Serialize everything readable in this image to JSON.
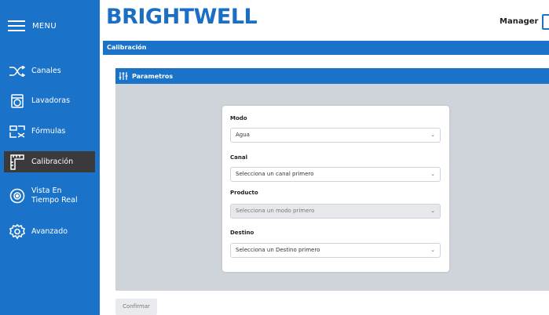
{
  "sidebar": {
    "menu_label": "MENU",
    "items": [
      {
        "label": "Canales",
        "icon": "shuffle-icon"
      },
      {
        "label": "Lavadoras",
        "icon": "washing-machine-icon"
      },
      {
        "label": "Fórmulas",
        "icon": "formula-icon"
      },
      {
        "label": "Calibración",
        "icon": "ruler-icon",
        "active": true
      },
      {
        "label": "Vista En Tiempo Real",
        "icon": "eye-icon"
      },
      {
        "label": "Avanzado",
        "icon": "gear-icon"
      }
    ]
  },
  "header": {
    "brand": "BRIGHTWELL",
    "user": "Manager"
  },
  "page": {
    "section_title": "Calibración",
    "panel_title": "Parametros"
  },
  "form": {
    "modo": {
      "label": "Modo",
      "value": "Agua"
    },
    "canal": {
      "label": "Canal",
      "value": "Selecciona un canal primero"
    },
    "producto": {
      "label": "Producto",
      "value": "Selecciona un modo primero"
    },
    "destino": {
      "label": "Destino",
      "value": "Selecciona un Destino primero"
    }
  },
  "actions": {
    "confirm": "Confirmar"
  },
  "colors": {
    "primary": "#1a73c8",
    "active_item": "#3a3a3a",
    "panel_bg": "#cfd3da"
  }
}
